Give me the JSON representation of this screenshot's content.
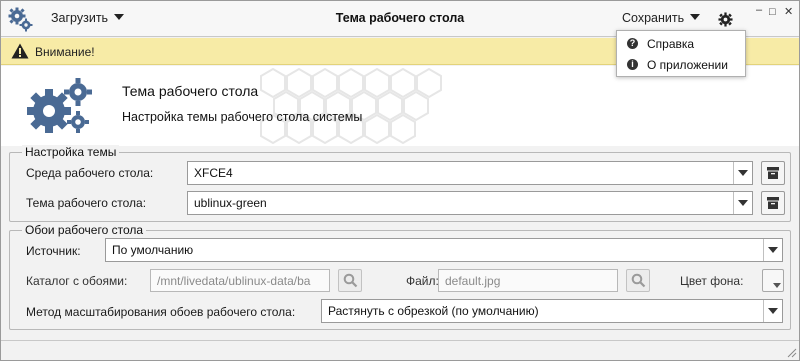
{
  "titlebar": {
    "load_label": "Загрузить",
    "title": "Тема рабочего стола",
    "save_label": "Сохранить",
    "controls": [
      "–",
      "□",
      "✕"
    ]
  },
  "menu": {
    "items": [
      {
        "label": "Справка",
        "icon": "question-icon",
        "glyph": "?"
      },
      {
        "label": "О приложении",
        "icon": "info-icon",
        "glyph": "i"
      }
    ]
  },
  "warning": {
    "text": "Внимание!"
  },
  "header": {
    "title": "Тема рабочего стола",
    "subtitle": "Настройка темы рабочего стола системы"
  },
  "theme_group": {
    "title": "Настройка темы",
    "env_label": "Среда рабочего стола:",
    "env_value": "XFCE4",
    "theme_label": "Тема рабочего стола:",
    "theme_value": "ublinux-green"
  },
  "wallpaper_group": {
    "title": "Обои рабочего стола",
    "source_label": "Источник:",
    "source_value": "По умолчанию",
    "dir_label": "Каталог с обоями:",
    "dir_value": "/mnt/livedata/ublinux-data/ba",
    "file_label": "Файл:",
    "file_value": "default.jpg",
    "bg_color_label": "Цвет фона:",
    "scale_label": "Метод масштабирования обоев рабочего стола:",
    "scale_value": "Растянуть с обрезкой (по умолчанию)"
  },
  "colors": {
    "gear_blue": "#4a6a94",
    "warning_bg": "#f7eba6"
  }
}
